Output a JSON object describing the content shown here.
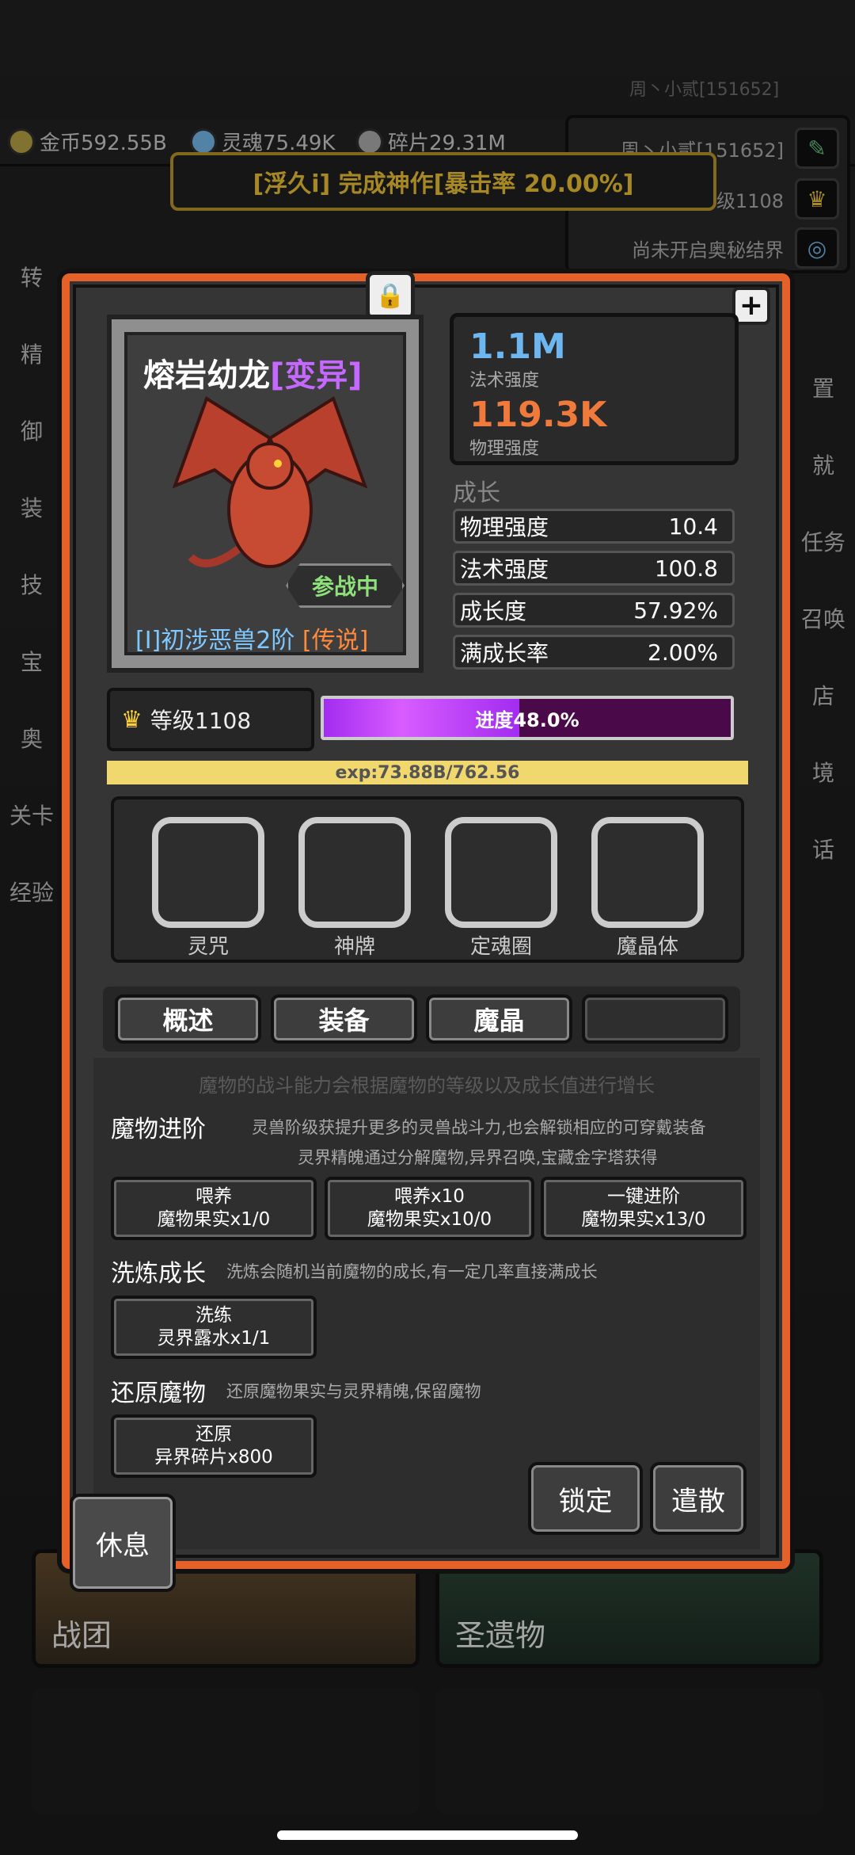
{
  "resources": [
    {
      "icon": "coin-icon",
      "label": "金币592.55B"
    },
    {
      "icon": "soul-icon",
      "label": "灵魂75.49K"
    },
    {
      "icon": "shard-icon",
      "label": "碎片29.31M"
    }
  ],
  "player": {
    "name_faint": "周丶小贰[151652]",
    "name": "周丶小贰[151652]",
    "level": "等级1108",
    "realm": "尚未开启奥秘结界"
  },
  "banner": "[浮久i] 完成神作[暴击率 20.00%]",
  "side_left": [
    "转",
    "精",
    "御",
    "装",
    "技",
    "宝",
    "奥",
    "关卡",
    "经验"
  ],
  "side_right": [
    "置",
    "就",
    "任务",
    "召唤",
    "店",
    "境",
    "话"
  ],
  "monster": {
    "name": "熔岩幼龙",
    "variant": "[变异]",
    "status": "参战中",
    "rank": "[I]初涉恶兽2阶",
    "rarity": "[传说]",
    "magic_power_value": "1.1M",
    "magic_power_label": "法术强度",
    "physical_power_value": "119.3K",
    "physical_power_label": "物理强度"
  },
  "growth": {
    "title": "成长",
    "rows": [
      {
        "label": "物理强度",
        "value": "10.4"
      },
      {
        "label": "法术强度",
        "value": "100.8"
      },
      {
        "label": "成长度",
        "value": "57.92%"
      },
      {
        "label": "满成长率",
        "value": "2.00%"
      }
    ]
  },
  "level": {
    "label": "等级1108",
    "progress_text": "进度48.0%",
    "progress_fraction": 0.48,
    "exp": "exp:73.88B/762.56"
  },
  "slots": [
    "灵咒",
    "神牌",
    "定魂圈",
    "魔晶体"
  ],
  "tabs": [
    "概述",
    "装备",
    "魔晶",
    ""
  ],
  "content": {
    "hint": "魔物的战斗能力会根据魔物的等级以及成长值进行增长",
    "advance": {
      "title": "魔物进阶",
      "desc1": "灵兽阶级获提升更多的灵兽战斗力,也会解锁相应的可穿戴装备",
      "desc2": "灵界精魄通过分解魔物,异界召唤,宝藏金字塔获得",
      "buttons": [
        {
          "line1": "喂养",
          "line2": "魔物果实x1/0"
        },
        {
          "line1": "喂养x10",
          "line2": "魔物果实x10/0"
        },
        {
          "line1": "一键进阶",
          "line2": "魔物果实x13/0"
        }
      ]
    },
    "refine": {
      "title": "洗炼成长",
      "desc": "洗炼会随机当前魔物的成长,有一定几率直接满成长",
      "button": {
        "line1": "洗练",
        "line2": "灵界露水x1/1"
      }
    },
    "restore": {
      "title": "还原魔物",
      "desc": "还原魔物果实与灵界精魄,保留魔物",
      "button": {
        "line1": "还原",
        "line2": "异界碎片x800"
      }
    },
    "lock_label": "锁定",
    "dismiss_label": "遣散"
  },
  "rest_label": "休息",
  "bottom_tiles": [
    "战团",
    "圣遗物"
  ],
  "colors": {
    "accent": "#e4622a",
    "gold": "#ffd23a",
    "magic": "#6db6f0",
    "physical": "#f07a3c",
    "variant": "#c468ff"
  }
}
